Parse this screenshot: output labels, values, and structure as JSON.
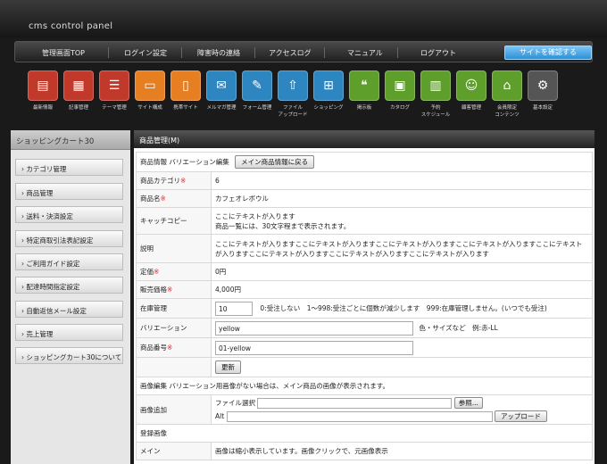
{
  "app": {
    "brand": "cms control panel"
  },
  "nav": {
    "items": [
      "管理画面TOP",
      "ログイン設定",
      "障害時の連絡",
      "アクセスログ",
      "マニュアル",
      "ログアウト"
    ],
    "site_button": "サイトを確認する"
  },
  "tools": [
    {
      "label": "最新情報",
      "icon": "news-icon",
      "color": "#c0392b"
    },
    {
      "label": "記事管理",
      "icon": "article-icon",
      "color": "#c0392b"
    },
    {
      "label": "テーマ管理",
      "icon": "list-icon",
      "color": "#c0392b"
    },
    {
      "label": "サイト構成",
      "icon": "monitor-icon",
      "color": "#e67e22"
    },
    {
      "label": "携帯サイト",
      "icon": "mobile-icon",
      "color": "#e67e22"
    },
    {
      "label": "メルマガ管理",
      "icon": "mail-icon",
      "color": "#2e86c1"
    },
    {
      "label": "フォーム管理",
      "icon": "form-icon",
      "color": "#2e86c1"
    },
    {
      "label": "ファイル\nアップロード",
      "icon": "upload-icon",
      "color": "#2e86c1"
    },
    {
      "label": "ショッピング",
      "icon": "cart-icon",
      "color": "#2e86c1"
    },
    {
      "label": "掲示板",
      "icon": "chat-icon",
      "color": "#5e9e2b"
    },
    {
      "label": "カタログ",
      "icon": "catalog-icon",
      "color": "#5e9e2b"
    },
    {
      "label": "予約\nスケジュール",
      "icon": "calendar-icon",
      "color": "#5e9e2b"
    },
    {
      "label": "顧客管理",
      "icon": "customer-icon",
      "color": "#5e9e2b"
    },
    {
      "label": "会員限定\nコンテンツ",
      "icon": "lock-icon",
      "color": "#5e9e2b"
    },
    {
      "label": "基本設定",
      "icon": "gear-icon",
      "color": "#555555"
    }
  ],
  "sidebar": {
    "title": "ショッピングカート30",
    "items": [
      "カテゴリ管理",
      "商品管理",
      "送料・決済設定",
      "特定商取引法表記設定",
      "ご利用ガイド設定",
      "配達時間指定設定",
      "自動返信メール設定",
      "売上管理",
      "ショッピングカート30について"
    ]
  },
  "main": {
    "title": "商品管理(M)",
    "info_label": "商品情報",
    "variation_edit": "バリエーション編集",
    "back_button": "メイン商品情報に戻る",
    "rows": {
      "category": {
        "label": "商品カテゴリ",
        "value": "6"
      },
      "name": {
        "label": "商品名",
        "value": "カフェオレボウル"
      },
      "catch": {
        "label": "キャッチコピー",
        "value1": "ここにテキストが入ります",
        "value2": "商品一覧には、30文字程まで表示されます。"
      },
      "desc": {
        "label": "説明",
        "value": "ここにテキストが入りますここにテキストが入りますここにテキストが入りますここにテキストが入りますここにテキストが入りますここにテキストが入りますここにテキストが入りますここにテキストが入ります"
      },
      "list_price": {
        "label": "定価",
        "value": "0円"
      },
      "sale_price": {
        "label": "販売価格",
        "value": "4,000円"
      },
      "stock": {
        "label": "在庫管理",
        "value": "10",
        "note": "0:受注しない　1〜998:受注ごとに個数が減少します　999:在庫管理しません。(いつでも受注)"
      },
      "variation": {
        "label": "バリエーション",
        "value": "yellow",
        "note": "色・サイズなど　例:赤-LL"
      },
      "code": {
        "label": "商品番号",
        "value": "01-yellow"
      }
    },
    "update_button": "更新",
    "image_edit": {
      "title": "画像編集",
      "note": "バリエーション用画像がない場合は、メイン商品の画像が表示されます。",
      "add_label": "画像追加",
      "file_label": "ファイル選択",
      "browse_button": "参照...",
      "alt_label": "Alt",
      "upload_button": "アップロード",
      "registered_label": "登録画像",
      "main_label": "メイン",
      "main_note": "画像は縮小表示しています。画像クリックで、元画像表示"
    },
    "required_mark": "※"
  }
}
